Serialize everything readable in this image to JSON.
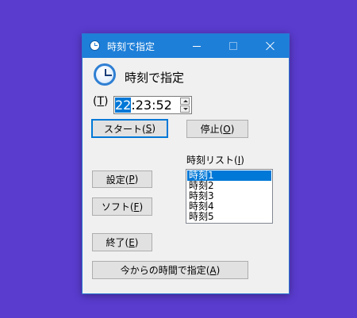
{
  "window": {
    "title": "時刻で指定"
  },
  "header": {
    "text": "時刻で指定"
  },
  "time_input": {
    "label_open": "(",
    "label_key": "T",
    "label_close": ")",
    "hours": "22",
    "rest": ":23:52"
  },
  "buttons": {
    "start": {
      "label": "スタート(",
      "key": "S",
      "close": ")"
    },
    "stop": {
      "label": "停止(",
      "key": "O",
      "close": ")"
    },
    "settings": {
      "label": "設定(",
      "key": "P",
      "close": ")"
    },
    "sort": {
      "label": "ソフト(",
      "key": "F",
      "close": ")"
    },
    "exit": {
      "label": "終了(",
      "key": "E",
      "close": ")"
    },
    "from_now": {
      "label": "今からの時間で指定(",
      "key": "A",
      "close": ")"
    }
  },
  "time_list": {
    "label_prefix": "時刻リスト(",
    "label_key": "I",
    "label_close": ")",
    "items": [
      "時刻1",
      "時刻2",
      "時刻3",
      "時刻4",
      "時刻5"
    ],
    "selected_index": 0
  },
  "colors": {
    "desktop": "#5a3ccf",
    "titlebar": "#1e7fd8",
    "selection": "#0078d7"
  }
}
